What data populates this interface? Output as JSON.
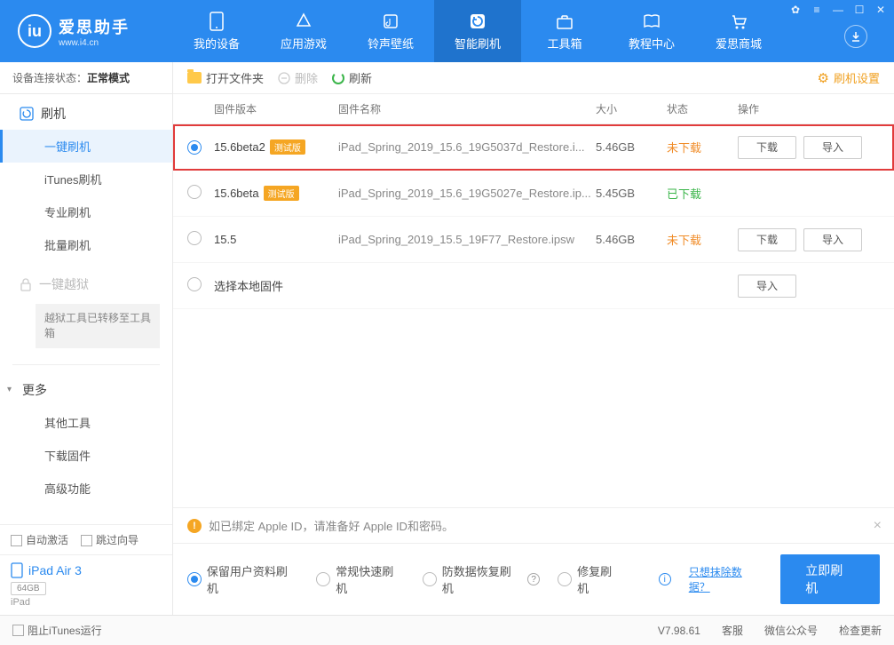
{
  "brand": {
    "name": "爱思助手",
    "url": "www.i4.cn"
  },
  "nav": [
    {
      "label": "我的设备"
    },
    {
      "label": "应用游戏"
    },
    {
      "label": "铃声壁纸"
    },
    {
      "label": "智能刷机"
    },
    {
      "label": "工具箱"
    },
    {
      "label": "教程中心"
    },
    {
      "label": "爱思商城"
    }
  ],
  "connection": {
    "label": "设备连接状态：",
    "value": "正常模式"
  },
  "sidebar": {
    "flash": {
      "head": "刷机",
      "one_key": "一键刷机",
      "itunes": "iTunes刷机",
      "pro": "专业刷机",
      "batch": "批量刷机"
    },
    "jailbreak": {
      "head": "一键越狱",
      "note": "越狱工具已转移至工具箱"
    },
    "more": {
      "head": "更多",
      "other": "其他工具",
      "download": "下载固件",
      "advanced": "高级功能"
    },
    "auto_activate": "自动激活",
    "skip_guide": "跳过向导",
    "device": {
      "name": "iPad Air 3",
      "storage": "64GB",
      "type": "iPad"
    }
  },
  "toolbar": {
    "open": "打开文件夹",
    "delete": "删除",
    "refresh": "刷新",
    "settings": "刷机设置"
  },
  "columns": {
    "version": "固件版本",
    "name": "固件名称",
    "size": "大小",
    "status": "状态",
    "ops": "操作"
  },
  "rows": [
    {
      "version": "15.6beta2",
      "beta": "测试版",
      "name": "iPad_Spring_2019_15.6_19G5037d_Restore.i...",
      "size": "5.46GB",
      "status": "未下载",
      "status_class": "status-notdl",
      "selected": true,
      "highlight": true,
      "download": "下载",
      "import": "导入"
    },
    {
      "version": "15.6beta",
      "beta": "测试版",
      "name": "iPad_Spring_2019_15.6_19G5027e_Restore.ip...",
      "size": "5.45GB",
      "status": "已下载",
      "status_class": "status-dl",
      "selected": false
    },
    {
      "version": "15.5",
      "beta": "",
      "name": "iPad_Spring_2019_15.5_19F77_Restore.ipsw",
      "size": "5.46GB",
      "status": "未下载",
      "status_class": "status-notdl",
      "selected": false,
      "download": "下载",
      "import": "导入"
    },
    {
      "version": "选择本地固件",
      "beta": "",
      "name": "",
      "size": "",
      "status": "",
      "status_class": "",
      "selected": false,
      "import": "导入"
    }
  ],
  "alert": "如已绑定 Apple ID，请准备好 Apple ID和密码。",
  "modes": {
    "keep": "保留用户资料刷机",
    "quick": "常规快速刷机",
    "antirec": "防数据恢复刷机",
    "repair": "修复刷机",
    "erase_link": "只想抹除数据？",
    "go": "立即刷机"
  },
  "footer": {
    "block_itunes": "阻止iTunes运行",
    "version": "V7.98.61",
    "service": "客服",
    "wechat": "微信公众号",
    "update": "检查更新"
  }
}
